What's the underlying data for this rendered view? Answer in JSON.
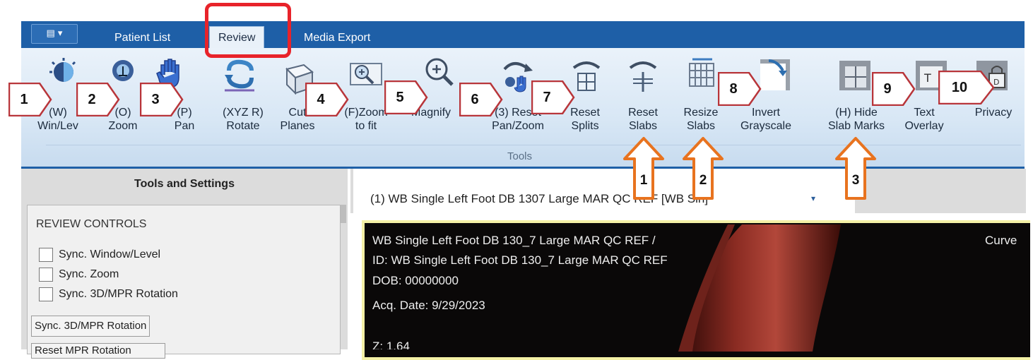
{
  "tabs": {
    "app_menu_icon": "layout-menu-icon",
    "app_menu_glyph": "▤ ▾",
    "items": [
      "Patient List",
      "Review",
      "Media Export"
    ],
    "active": "Review"
  },
  "ribbon": {
    "group_label": "Tools",
    "tools": [
      {
        "label": "(W)\nWin/Lev",
        "icon": "window-level-icon"
      },
      {
        "label": "(O)\nZoom",
        "icon": "zoom-icon"
      },
      {
        "label": "(P)\nPan",
        "icon": "hand-icon"
      },
      {
        "label": "(XYZ R)\nRotate",
        "icon": "rotate-icon"
      },
      {
        "label": "Cut\nPlanes",
        "icon": "cube-icon"
      },
      {
        "label": "(F)Zoom\nto fit",
        "icon": "zoom-fit-icon"
      },
      {
        "label": "Magnify",
        "icon": "magnifier-icon"
      },
      {
        "label": "(3) Reset\nPan/Zoom",
        "icon": "reset-pan-zoom-icon"
      },
      {
        "label": "Reset\nSplits",
        "icon": "reset-splits-icon"
      },
      {
        "label": "Reset\nSlabs",
        "icon": "reset-slabs-icon"
      },
      {
        "label": "Resize\nSlabs",
        "icon": "resize-slabs-icon"
      },
      {
        "label": "Invert\nGrayscale",
        "icon": "invert-grayscale-icon"
      },
      {
        "label": "(H) Hide\nSlab Marks",
        "icon": "hide-slab-marks-icon"
      },
      {
        "label": "Text\nOverlay",
        "icon": "text-overlay-icon"
      },
      {
        "label": "Privacy",
        "icon": "privacy-lock-icon"
      }
    ]
  },
  "left_panel": {
    "title": "Tools and Settings",
    "section": "REVIEW CONTROLS",
    "checkboxes": [
      "Sync. Window/Level",
      "Sync. Zoom",
      "Sync. 3D/MPR Rotation"
    ],
    "button": "Sync. 3D/MPR Rotation",
    "button2": "Reset MPR Rotation"
  },
  "viewer": {
    "tab_title": "(1) WB Single Left Foot DB 1307 Large MAR QC REF [WB Sin]",
    "dropdown_glyph": "▾",
    "overlay": [
      "WB Single Left Foot DB 130_7 Large MAR QC REF /",
      "ID: WB Single Left Foot DB 130_7 Large MAR QC REF",
      "DOB: 00000000",
      "Acq. Date: 9/29/2023",
      "Z: 1.64"
    ],
    "overlay_right": "Curve"
  },
  "annotations": {
    "markers": [
      "1",
      "2",
      "3",
      "4",
      "5",
      "6",
      "7",
      "8",
      "9",
      "10"
    ],
    "arrows": [
      "1",
      "2",
      "3"
    ],
    "colors": {
      "marker_border": "#b8353a",
      "arrow": "#e8731f",
      "highlight": "#e8232a"
    }
  }
}
